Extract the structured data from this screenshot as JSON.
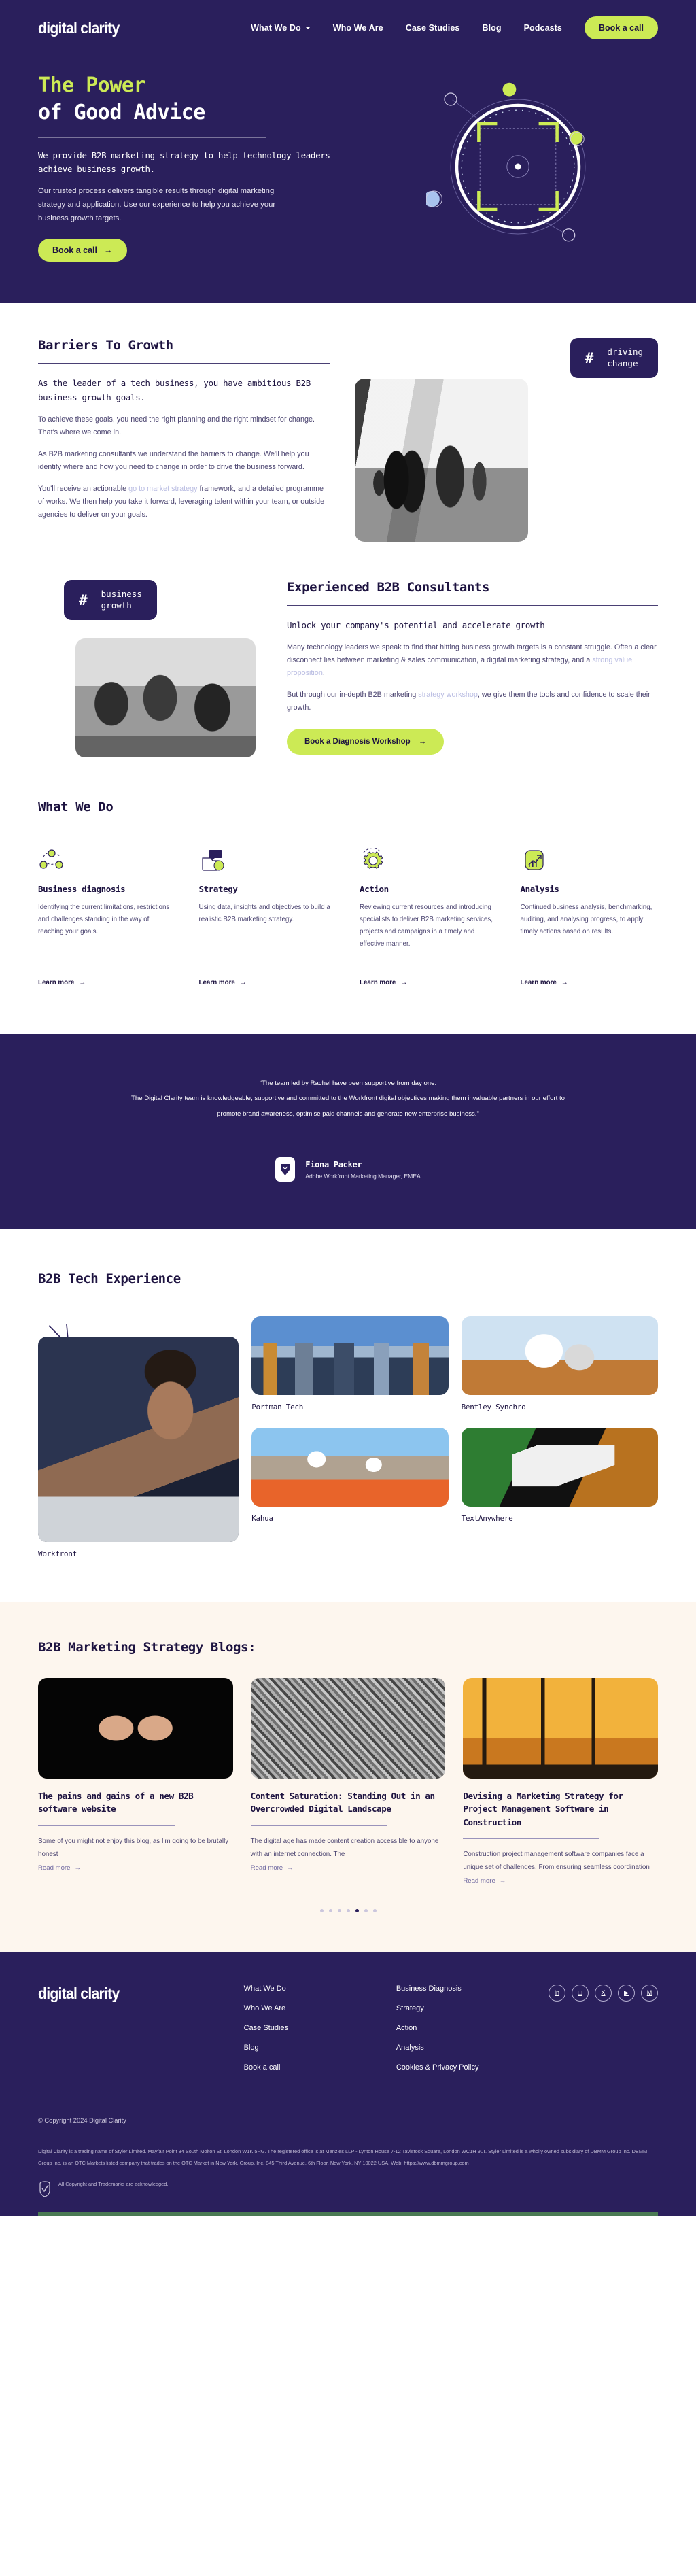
{
  "brand": {
    "name": "digital clarity"
  },
  "nav": {
    "items": [
      {
        "label": "What We Do",
        "has_caret": true
      },
      {
        "label": "Who We Are",
        "has_caret": false
      },
      {
        "label": "Case Studies",
        "has_caret": false
      },
      {
        "label": "Blog",
        "has_caret": false
      },
      {
        "label": "Podcasts",
        "has_caret": false
      }
    ],
    "cta": "Book a call"
  },
  "hero": {
    "title_line1": "The Power",
    "title_line2": "of Good Advice",
    "subtitle": "We provide B2B marketing strategy to help technology leaders achieve business growth.",
    "body": "Our trusted process delivers tangible results through digital marketing strategy and application. Use our experience to help you achieve your business growth targets.",
    "cta": "Book a call",
    "cta_arrow": "→"
  },
  "barriers": {
    "title": "Barriers To Growth",
    "lead": "As the leader of a tech business, you have ambitious B2B business growth goals.",
    "p1": "To achieve these goals, you need the right planning and the right mindset for change. That's where we come in.",
    "p2": "As B2B marketing consultants we understand the barriers to change. We'll help you identify where and how you need to change in order to drive the business forward.",
    "p3_before": "You'll receive an actionable ",
    "p3_link": "go to market strategy",
    "p3_after": " framework, and a detailed programme of works. We then help you take it forward, leveraging talent within your team, or outside agencies to deliver on your goals.",
    "badge_hash": "#",
    "badge_text_line1": "driving",
    "badge_text_line2": "change"
  },
  "consultants": {
    "badge_hash": "#",
    "badge_text_line1": "business",
    "badge_text_line2": "growth",
    "title": "Experienced B2B Consultants",
    "lead": "Unlock your company's potential and accelerate growth",
    "p1_a": "Many technology leaders we speak to find that hitting business growth targets is a constant struggle. Often a clear disconnect lies between marketing & sales communication, a digital marketing strategy, and a ",
    "p1_link": "strong value proposition",
    "p1_b": ".",
    "p2_a": "But through our in-depth B2B marketing ",
    "p2_link": "strategy workshop",
    "p2_b": ", we give them the tools and confidence to scale their growth.",
    "cta": "Book a Diagnosis Workshop",
    "cta_arrow": "→"
  },
  "what_we_do": {
    "title": "What We Do",
    "learn_more": "Learn more",
    "arrow": "→",
    "cards": [
      {
        "icon": "network-nodes-icon",
        "title": "Business diagnosis",
        "text": "Identifying the current limitations, restrictions and challenges standing in the way of reaching your goals."
      },
      {
        "icon": "chat-folder-icon",
        "title": "Strategy",
        "text": "Using data, insights and objectives to build a realistic B2B marketing strategy."
      },
      {
        "icon": "gear-icon",
        "title": "Action",
        "text": "Reviewing current resources and introducing specialists to deliver B2B marketing services, projects and campaigns in a timely and effective manner."
      },
      {
        "icon": "growth-chart-icon",
        "title": "Analysis",
        "text": "Continued business analysis, benchmarking, auditing, and analysing progress, to apply timely actions based on results."
      }
    ]
  },
  "testimonial": {
    "line1": "“The team led by Rachel have been supportive from day one.",
    "line2": "The Digital Clarity team is knowledgeable, supportive and committed to the Workfront digital objectives making them invaluable partners in our effort to",
    "line3": "promote brand awareness, optimise paid channels and generate new enterprise business.\"",
    "name": "Fiona Packer",
    "role": "Adobe Workfront  Marketing Manager, EMEA"
  },
  "tech": {
    "title": "B2B Tech Experience",
    "cards": [
      {
        "label": "Workfront",
        "image": "woman-at-laptop-photo"
      },
      {
        "label": "Portman Tech",
        "image": "london-skyline-photo"
      },
      {
        "label": "Bentley Synchro",
        "image": "vr-headset-photo"
      },
      {
        "label": "Kahua",
        "image": "construction-workers-photo"
      },
      {
        "label": "TextAnywhere",
        "image": "phone-messaging-apps-photo"
      }
    ]
  },
  "blogs": {
    "title": "B2B Marketing Strategy Blogs:",
    "read_more": "Read more",
    "arrow": "→",
    "items": [
      {
        "title": "The pains and gains of a new B2B software website",
        "excerpt": "Some of you might not enjoy this blog, as I'm going to be brutally honest",
        "image": "pain-gain-fists-photo"
      },
      {
        "title": "Content Saturation: Standing Out in an Overcrowded Digital Landscape",
        "excerpt": "The digital age has made content creation accessible to anyone with an internet connection. The",
        "image": "crowd-photo"
      },
      {
        "title": "Devising a Marketing Strategy for Project Management Software in Construction",
        "excerpt": "Construction project management software companies face a unique set of challenges. From ensuring seamless coordination",
        "image": "construction-cranes-sunset-photo"
      }
    ],
    "dots": 7,
    "active_dot": 4
  },
  "footer": {
    "logo": "digital clarity",
    "col1": [
      "What We Do",
      "Who We Are",
      "Case Studies",
      "Blog",
      "Book a call"
    ],
    "col2": [
      "Business Diagnosis",
      "Strategy",
      "Action",
      "Analysis",
      "Cookies & Privacy Policy"
    ],
    "social": [
      {
        "name": "linkedin-icon",
        "glyph": "in"
      },
      {
        "name": "instagram-icon",
        "glyph": "□"
      },
      {
        "name": "x-twitter-icon",
        "glyph": "X"
      },
      {
        "name": "youtube-icon",
        "glyph": "▶"
      },
      {
        "name": "medium-icon",
        "glyph": "M"
      }
    ],
    "copyright": "© Copyright 2024 Digital Clarity",
    "legal": "Digital Clarity is a trading name of Styler Limited. Mayfair Point 34 South Molton St. London W1K 5RG. The registered office is at Menzies LLP - Lynton House 7-12 Tavistock Square, London WC1H 9LT. Styler Limited is a wholly owned subsidiary of DBMM Group Inc. DBMM Group Inc. is an OTC Markets listed company that trades on the OTC Market in New York. Group, Inc. 845 Third Avenue, 6th Floor, New York, NY 10022 USA. Web: https://www.dbmmgroup.com",
    "acknowledgement": "All Copyright and Trademarks are acknowledged."
  },
  "colors": {
    "primary": "#2a1f5c",
    "accent_lime": "#ccea55",
    "cream": "#fdf6ee",
    "link": "#b9bce2"
  }
}
